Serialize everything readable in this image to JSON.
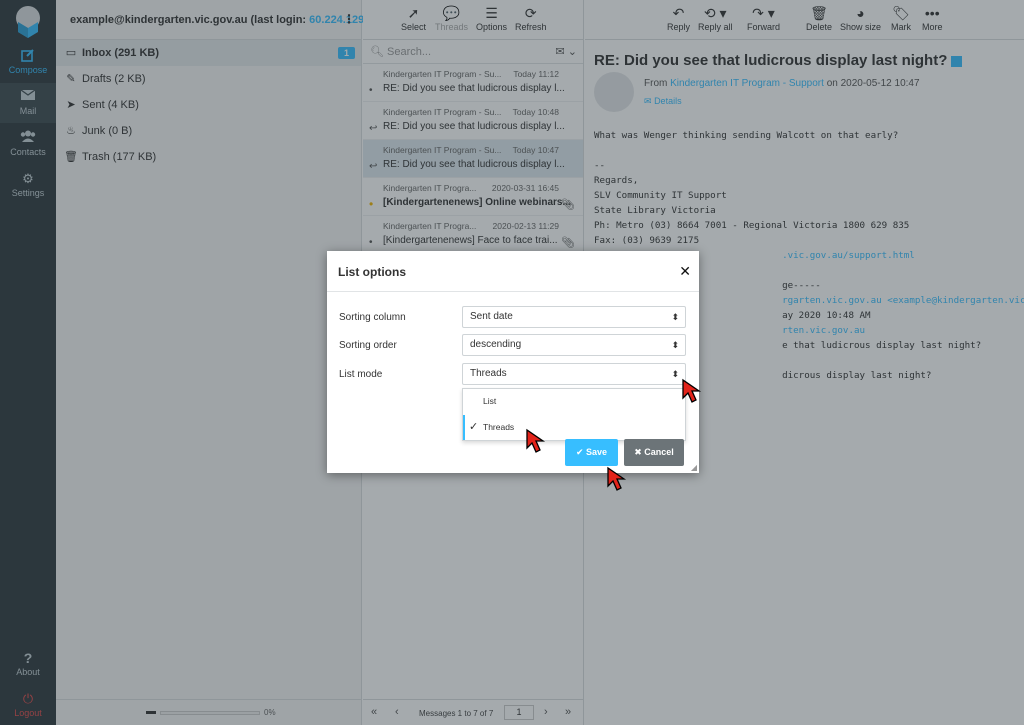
{
  "nav": {
    "compose": "Compose",
    "mail": "Mail",
    "contacts": "Contacts",
    "settings": "Settings",
    "about": "About",
    "logout": "Logout"
  },
  "account": {
    "email": "example@kindergarten.vic.gov.au",
    "last_login_prefix": "(last login:",
    "last_login_ip": "60.224.129.25..."
  },
  "folders": [
    {
      "name": "Inbox",
      "size": "(291 KB)",
      "badge": "1"
    },
    {
      "name": "Drafts",
      "size": "(2 KB)"
    },
    {
      "name": "Sent",
      "size": "(4 KB)"
    },
    {
      "name": "Junk",
      "size": "(0 B)"
    },
    {
      "name": "Trash",
      "size": "(177 KB)"
    }
  ],
  "quota": {
    "percent": "0%"
  },
  "list_toolbar": {
    "select": "Select",
    "threads": "Threads",
    "options": "Options",
    "refresh": "Refresh"
  },
  "search": {
    "placeholder": "Search..."
  },
  "messages": [
    {
      "from": "Kindergarten IT Program - Su...",
      "date": "Today 11:12",
      "subject": "RE: Did you see that ludicrous display l...",
      "marker": "•"
    },
    {
      "from": "Kindergarten IT Program - Su...",
      "date": "Today 10:48",
      "subject": "RE: Did you see that ludicrous display l...",
      "marker": "↩"
    },
    {
      "from": "Kindergarten IT Program - Su...",
      "date": "Today 10:47",
      "subject": "RE: Did you see that ludicrous display l...",
      "marker": "↩"
    },
    {
      "from": "Kindergarten IT Progra...",
      "date": "2020-03-31 16:45",
      "subject": "[Kindergartenenews] Online webinars...",
      "marker": "•"
    },
    {
      "from": "Kindergarten IT Progra...",
      "date": "2020-02-13 11:29",
      "subject": "[Kindergartenenews] Face to face trai...",
      "marker": "•"
    }
  ],
  "pager": {
    "info": "Messages 1 to 7 of 7",
    "page": "1"
  },
  "reader_toolbar": {
    "reply": "Reply",
    "reply_all": "Reply all",
    "forward": "Forward",
    "delete": "Delete",
    "show_size": "Show size",
    "mark": "Mark",
    "more": "More"
  },
  "email": {
    "subject": "RE: Did you see that ludicrous display last night?",
    "from_label": "From",
    "from_name": "Kindergarten IT Program - Support",
    "date": "on 2020-05-12 10:47",
    "details": "Details",
    "body_line1": "What was Wenger thinking sending Walcott on that early?",
    "body_sig": "--\nRegards,\nSLV Community IT Support\nState Library Victoria\nPh: Metro (03) 8664 7001 - Regional Victoria 1800 629 835\nFax: (03) 9639 2175",
    "body_link": ".vic.gov.au/support.html",
    "body_q1": "ge-----",
    "body_q2a": "rgarten.vic.gov.au ",
    "body_q2b": "<example@kindergarten.vic.gov.au>",
    "body_q3": "ay 2020 10:48 AM",
    "body_q4": "rten.vic.gov.au",
    "body_q5": "e that ludicrous display last night?",
    "body_q6": "dicrous display last night?"
  },
  "dialog": {
    "title": "List options",
    "sorting_column_label": "Sorting column",
    "sorting_column_value": "Sent date",
    "sorting_order_label": "Sorting order",
    "sorting_order_value": "descending",
    "list_mode_label": "List mode",
    "list_mode_value": "Threads",
    "options": [
      "List",
      "Threads"
    ],
    "save": "Save",
    "cancel": "Cancel"
  },
  "colors": {
    "accent": "#37beff",
    "nav_bg": "#2f3a3f",
    "logout": "#e24b4b",
    "cursor": "#e2231a"
  }
}
